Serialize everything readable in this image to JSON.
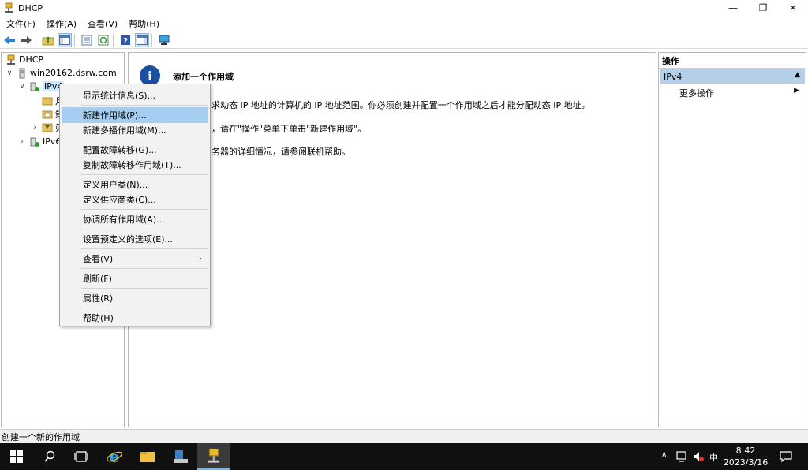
{
  "window": {
    "title": "DHCP",
    "minimize": "—",
    "restore": "❐",
    "close": "✕"
  },
  "menubar": [
    {
      "label": "文件(F)"
    },
    {
      "label": "操作(A)"
    },
    {
      "label": "查看(V)"
    },
    {
      "label": "帮助(H)"
    }
  ],
  "toolbar": {
    "icons": [
      "back-arrow-icon",
      "forward-arrow-icon",
      "up-folder-icon",
      "show-hide-tree-icon",
      "export-list-icon",
      "refresh-icon",
      "help-icon",
      "console-icon",
      "monitor-icon"
    ]
  },
  "tree": {
    "root": "DHCP",
    "server": "win20162.dsrw.com",
    "ipv4": "IPv4",
    "ipv4_child1": "月",
    "ipv4_child2": "策",
    "ipv4_child3": "筛",
    "ipv6": "IPv6"
  },
  "content": {
    "title": "添加一个作用域",
    "line1": "请求动态 IP 地址的计算机的 IP 地址范围。你必须创建并配置一个作用域之后才能分配动态 IP 地址。",
    "line2": "域，请在\"操作\"菜单下单击\"新建作用域\"。",
    "line3": "服务器的详细情况，请参阅联机帮助。"
  },
  "actions": {
    "header": "操作",
    "section": "IPv4",
    "more": "更多操作"
  },
  "context_menu": {
    "items": [
      {
        "label": "显示统计信息(S)..."
      },
      {
        "label": "新建作用域(P)..."
      },
      {
        "label": "新建多播作用域(M)..."
      },
      {
        "label": "配置故障转移(G)..."
      },
      {
        "label": "复制故障转移作用域(T)..."
      },
      {
        "label": "定义用户类(N)..."
      },
      {
        "label": "定义供应商类(C)..."
      },
      {
        "label": "协调所有作用域(A)..."
      },
      {
        "label": "设置预定义的选项(E)..."
      },
      {
        "label": "查看(V)"
      },
      {
        "label": "刷新(F)"
      },
      {
        "label": "属性(R)"
      },
      {
        "label": "帮助(H)"
      }
    ],
    "highlighted": "新建作用域(P)..."
  },
  "statusbar": {
    "text": "创建一个新的作用域"
  },
  "taskbar": {
    "ime": "中",
    "time": "8:42",
    "date": "2023/3/16"
  }
}
